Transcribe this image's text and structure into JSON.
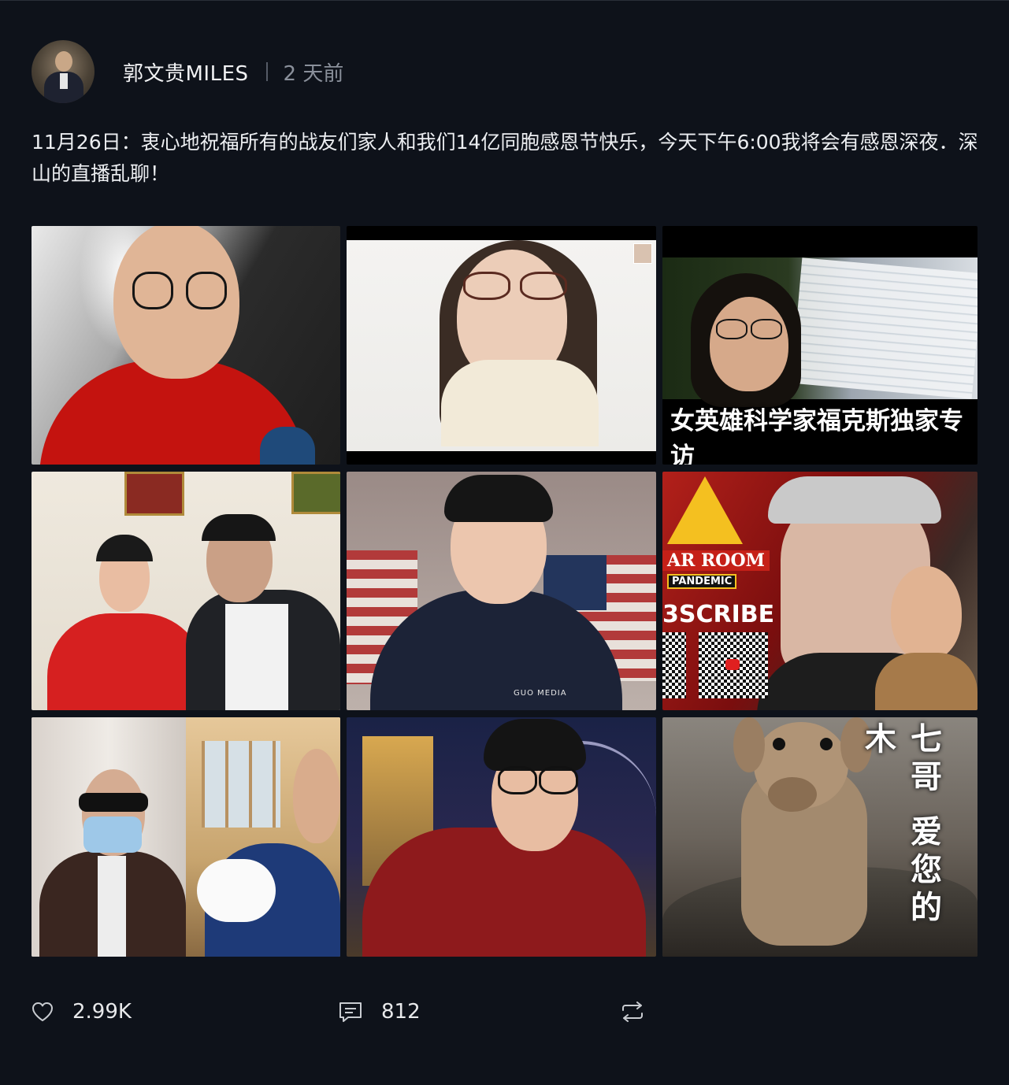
{
  "post": {
    "author": "郭文贵MILES",
    "time": "2 天前",
    "text": "11月26日：衷心地祝福所有的战友们家人和我们14亿同胞感恩节快乐，今天下午6:00我将会有感恩深夜．深山的直播乱聊！"
  },
  "images": {
    "tile3_caption": "女英雄科学家福克斯独家专访",
    "tile6_war_room": "AR ROOM",
    "tile6_pandemic": "PANDEMIC",
    "tile6_subscribe": "3SCRIBE",
    "tile5_shirt_logo": "GUO MEDIA",
    "tile9_vertical": "七哥 爱您的木"
  },
  "actions": {
    "likes": "2.99K",
    "comments": "812"
  },
  "icons": {
    "like": "heart-icon",
    "comment": "comment-icon",
    "repost": "repost-icon"
  },
  "colors": {
    "background": "#0e121a",
    "text": "#eceef1",
    "muted": "#8a909b"
  }
}
